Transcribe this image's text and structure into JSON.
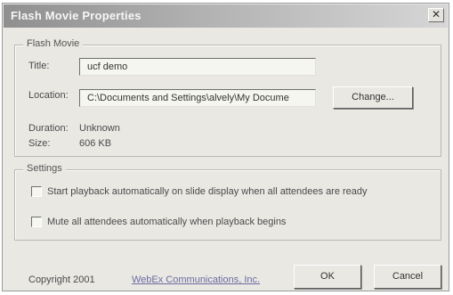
{
  "window": {
    "title": "Flash Movie Properties",
    "close_label": "✕"
  },
  "flash_movie": {
    "legend": "Flash Movie",
    "title_label": "Title:",
    "title_value": "ucf demo",
    "location_label": "Location:",
    "location_value": "C:\\Documents and Settings\\alvely\\My Docume",
    "change_button": "Change...",
    "duration_label": "Duration:",
    "duration_value": "Unknown",
    "size_label": "Size:",
    "size_value": "606 KB"
  },
  "settings": {
    "legend": "Settings",
    "options": [
      {
        "label": "Start playback automatically on slide display when all attendees are ready",
        "checked": false
      },
      {
        "label": "Mute all attendees automatically when playback begins",
        "checked": false
      }
    ]
  },
  "footer": {
    "copyright": "Copyright 2001",
    "company_link": "WebEx Communications, Inc.",
    "ok_button": "OK",
    "cancel_button": "Cancel"
  }
}
